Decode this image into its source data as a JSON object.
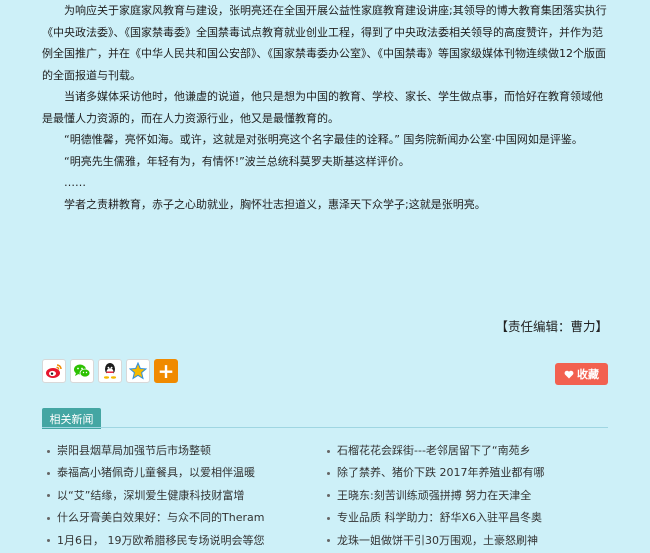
{
  "article": {
    "paragraphs": [
      {
        "text": "为响应关于家庭家风教育与建设，张明亮还在全国开展公益性家庭教育建设讲座;其领导的博大教育集团落实执行《中央政法委》、《国家禁毒委》全国禁毒试点教育就业创业工程，得到了中央政法委相关领导的高度赞许，并作为范例全国推广，并在《中华人民共和国公安部》、《国家禁毒委办公室》、《中国禁毒》等国家级媒体刊物连续做12个版面的全面报道与刊载。",
        "indent": true
      },
      {
        "text": "当诸多媒体采访他时，他谦虚的说道，他只是想为中国的教育、学校、家长、学生做点事，而恰好在教育领域他是最懂人力资源的，而在人力资源行业，他又是最懂教育的。",
        "indent": true
      },
      {
        "text": "“明德惟馨，亮怀如海。或许，这就是对张明亮这个名字最佳的诠释。” 国务院新闻办公室·中国网如是评鉴。",
        "indent": true
      },
      {
        "text": "“明亮先生儒雅，年轻有为，有情怀!”波兰总统科莫罗夫斯基这样评价。",
        "indent": true
      },
      {
        "text": "……",
        "indent": true
      },
      {
        "text": "学者之责耕教育，赤子之心助就业，胸怀壮志担道义，惠泽天下众学子;这就是张明亮。",
        "indent": true
      }
    ]
  },
  "editor": "【责任编辑：曹力】",
  "share": {
    "icons": [
      "weibo-icon",
      "wechat-icon",
      "qq-icon",
      "qzone-icon",
      "more-icon"
    ],
    "more_glyph": "+"
  },
  "favorite": {
    "label": "收藏",
    "color": "#f26150"
  },
  "related": {
    "tab_label": "相关新闻",
    "tab_color": "#44a6a3",
    "left": [
      "崇阳县烟草局加强节后市场整顿",
      "泰福高小猪佩奇儿童餐具，以爱相伴温暖",
      "以“艾”结缘，深圳爱生健康科技财富增",
      "什么牙膏美白效果好：与众不同的Theram",
      "1月6日， 19万欧希腊移民专场说明会等您"
    ],
    "right": [
      "石榴花花会踩街---老邻居留下了“南苑乡",
      "除了禁养、猪价下跌 2017年养殖业都有哪",
      "王晓东:刻苦训练顽强拼搏 努力在天津全",
      "专业品质 科学助力：舒华X6入驻平昌冬奥",
      "龙珠一姐做饼干引30万围观，土豪怒刷神"
    ]
  }
}
